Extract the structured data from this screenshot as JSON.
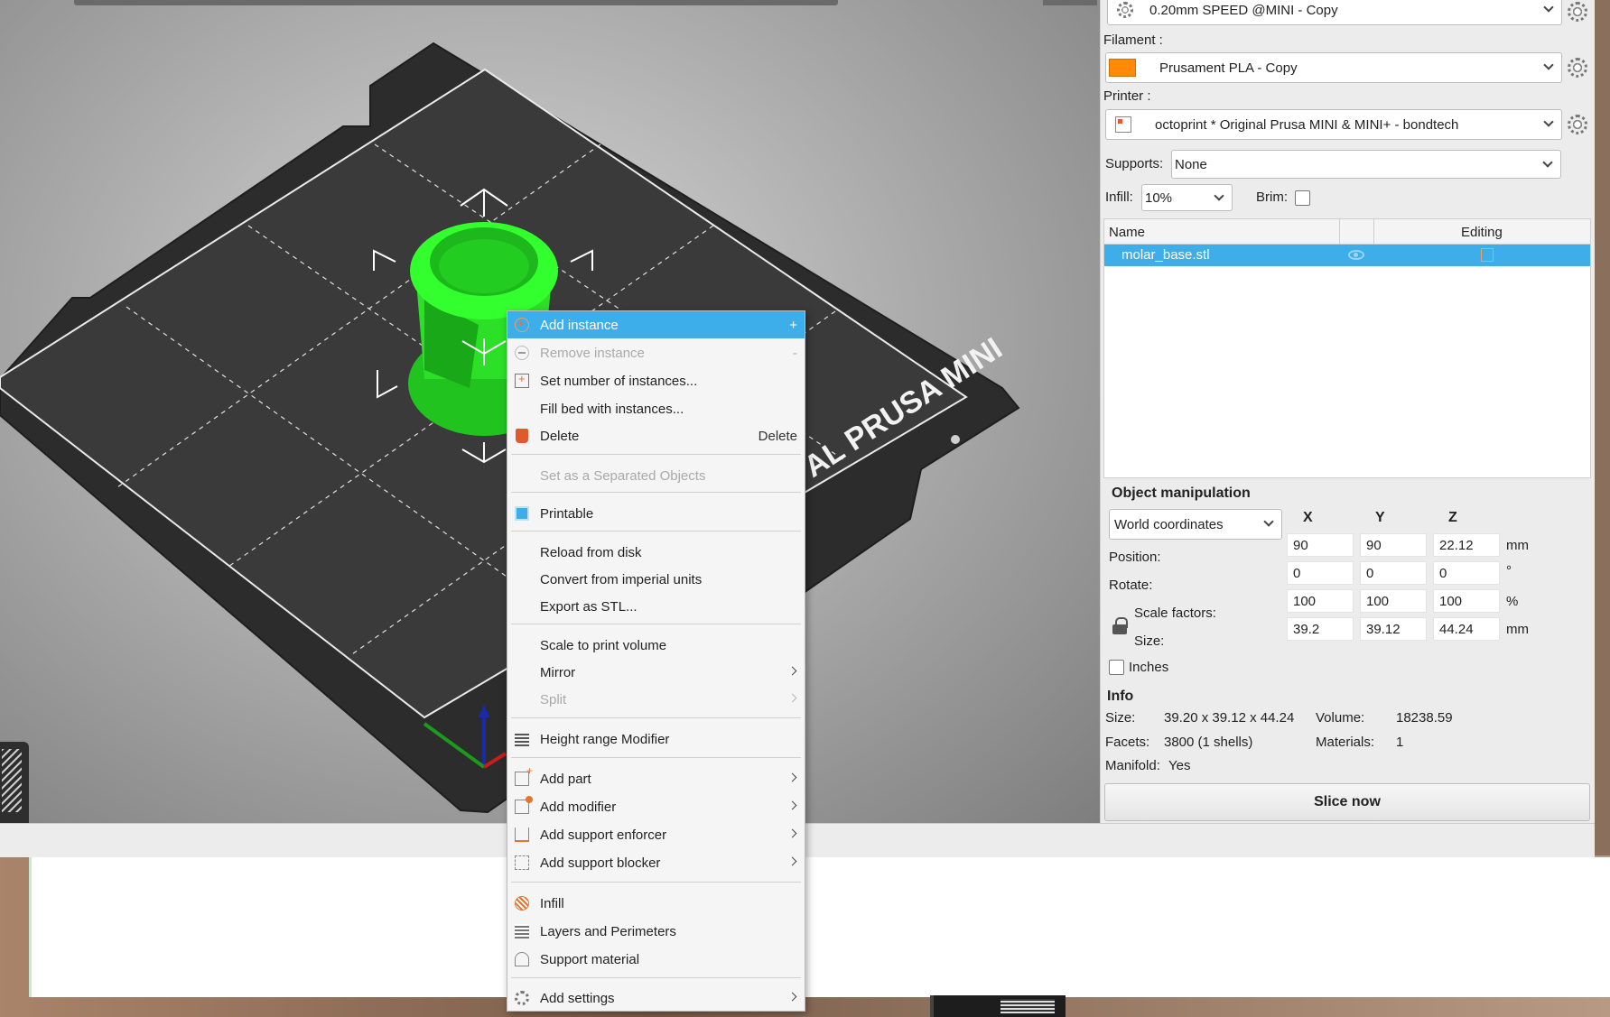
{
  "print_settings": {
    "value": "0.20mm SPEED @MINI - Copy"
  },
  "filament": {
    "label": "Filament :",
    "value": "Prusament PLA - Copy",
    "color": "#ff8a0a"
  },
  "printer": {
    "label": "Printer :",
    "value": "octoprint * Original Prusa MINI & MINI+ - bondtech"
  },
  "supports": {
    "label": "Supports:",
    "value": "None"
  },
  "infill": {
    "label": "Infill:",
    "value": "10%"
  },
  "brim": {
    "label": "Brim:",
    "checked": false
  },
  "object_list": {
    "col_name": "Name",
    "col_editing": "Editing",
    "items": [
      {
        "name": "molar_base.stl",
        "selected": true
      }
    ]
  },
  "bed_label": "AL PRUSA MINI",
  "manipulation": {
    "title": "Object manipulation",
    "coord_system": "World coordinates",
    "axes": [
      "X",
      "Y",
      "Z"
    ],
    "position": {
      "label": "Position:",
      "x": "90",
      "y": "90",
      "z": "22.12",
      "unit": "mm"
    },
    "rotate": {
      "label": "Rotate:",
      "x": "0",
      "y": "0",
      "z": "0",
      "unit": "°"
    },
    "scale": {
      "label": "Scale factors:",
      "x": "100",
      "y": "100",
      "z": "100",
      "unit": "%"
    },
    "size": {
      "label": "Size:",
      "x": "39.2",
      "y": "39.12",
      "z": "44.24",
      "unit": "mm"
    },
    "inches_label": "Inches"
  },
  "info": {
    "title": "Info",
    "size_label": "Size:",
    "size_value": "39.20 x 39.12 x 44.24",
    "volume_label": "Volume:",
    "volume_value": "18238.59",
    "facets_label": "Facets:",
    "facets_value": "3800 (1 shells)",
    "materials_label": "Materials:",
    "materials_value": "1",
    "manifold_label": "Manifold:",
    "manifold_value": "Yes"
  },
  "slice_button": "Slice now",
  "context_menu": {
    "add_instance": {
      "label": "Add instance",
      "shortcut": "+"
    },
    "remove_instance": {
      "label": "Remove instance",
      "shortcut": "-"
    },
    "set_number": "Set number of instances...",
    "fill_bed": "Fill bed with instances...",
    "delete": {
      "label": "Delete",
      "shortcut": "Delete"
    },
    "separated": "Set as a Separated Objects",
    "printable": "Printable",
    "reload": "Reload from disk",
    "convert_imperial": "Convert from imperial units",
    "export_stl": "Export as STL...",
    "scale_volume": "Scale to print volume",
    "mirror": "Mirror",
    "split": "Split",
    "height_range": "Height range Modifier",
    "add_part": "Add part",
    "add_modifier": "Add modifier",
    "add_enforcer": "Add support enforcer",
    "add_blocker": "Add support blocker",
    "infill": "Infill",
    "layers": "Layers and Perimeters",
    "support_material": "Support material",
    "add_settings": "Add settings"
  }
}
